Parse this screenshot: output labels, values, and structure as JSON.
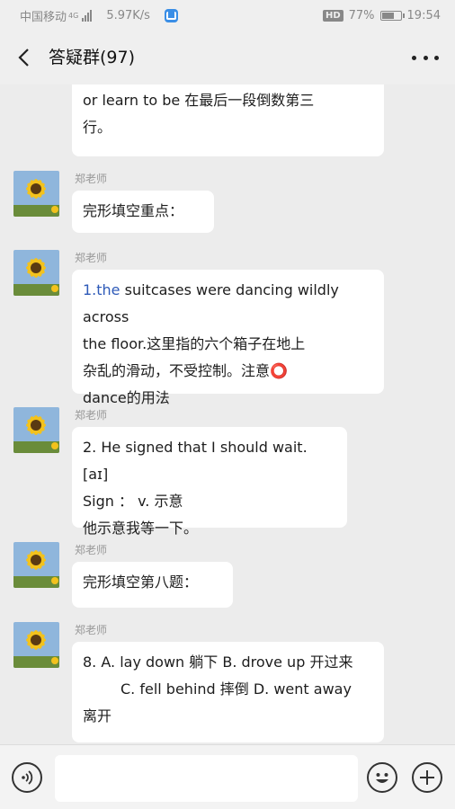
{
  "status_bar": {
    "carrier": "中国移动",
    "network": "4G",
    "speed": "5.97K/s",
    "hd": "HD",
    "battery": "77%",
    "battery_level": 0.77,
    "time": "19:54"
  },
  "header": {
    "title": "答疑群(97)"
  },
  "messages": [
    {
      "lines": [
        "or learn to be 在最后一段倒数第三",
        "行。"
      ]
    },
    {
      "sender": "郑老师",
      "lines": [
        "完形填空重点："
      ]
    },
    {
      "sender": "郑老师",
      "highlight": "1.the",
      "lines": [
        " suitcases were dancing wildly across",
        "the floor.这里指的六个箱子在地上",
        "杂乱的滑动，不受控制。注意⭕",
        "dance的用法"
      ]
    },
    {
      "sender": "郑老师",
      "lines": [
        "2. He signed  that I should wait. [aɪ]",
        "Sign ： v. 示意",
        "他示意我等一下。"
      ]
    },
    {
      "sender": "郑老师",
      "lines": [
        "完形填空第八题："
      ]
    },
    {
      "sender": "郑老师",
      "lines": [
        "8. A. lay down 躺下 B. drove up 开过来",
        "C. fell behind 摔倒   D. went away",
        "离开"
      ]
    }
  ],
  "icons": {
    "back": "chevron-left-icon",
    "more": "more-dots-icon",
    "voice": "voice-icon",
    "emoji": "emoji-icon",
    "plus": "plus-icon"
  },
  "colors": {
    "background": "#ececec",
    "bubble": "#ffffff",
    "link": "#2e5ab8"
  }
}
